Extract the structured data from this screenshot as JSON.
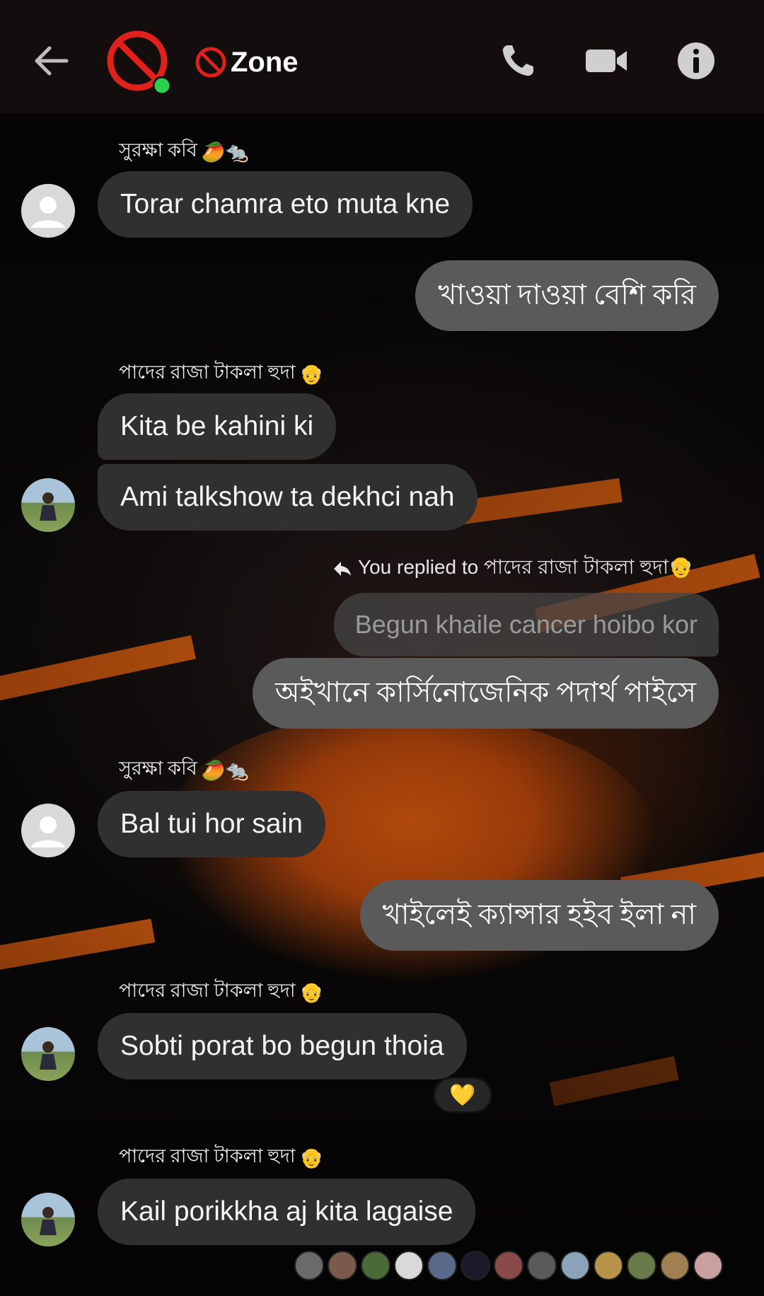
{
  "header": {
    "group_name": "Zone",
    "status": "online"
  },
  "messages": [
    {
      "sender": "সুরক্ষা কবি",
      "sender_emoji": "🥭🐀",
      "text": "Torar chamra eto muta kne"
    },
    {
      "outgoing": "খাওয়া দাওয়া বেশি করি"
    },
    {
      "sender": "পাদের রাজা টাকলা হুদা",
      "sender_emoji": "👴",
      "text1": "Kita be kahini ki",
      "text2": "Ami talkshow ta dekhci nah"
    },
    {
      "reply_note": "You replied to পাদের রাজা টাকলা হুদা👴",
      "quoted": "Begun khaile cancer hoibo kor",
      "outgoing": "অইখানে কার্সিনোজেনিক পদার্থ পাইসে"
    },
    {
      "sender": "সুরক্ষা কবি",
      "sender_emoji": "🥭🐀",
      "text": "Bal tui hor sain"
    },
    {
      "outgoing": "খাইলেই ক্যান্সার হইব ইলা না"
    },
    {
      "sender": "পাদের রাজা টাকলা হুদা",
      "sender_emoji": "👴",
      "text": "Sobti porat bo begun thoia",
      "reaction": "💛"
    },
    {
      "sender": "পাদের রাজা টাকলা হুদা",
      "sender_emoji": "👴",
      "text": "Kail porikkha aj kita lagaise"
    }
  ],
  "colors": {
    "header_bg": "#140d0d",
    "incoming_bubble": "#303030",
    "outgoing_bubble": "#5a5a5a",
    "accent_red": "#e0201b",
    "online_green": "#2bd14e",
    "orange": "#d9590c"
  },
  "icons": {
    "back": "arrow-left-icon",
    "group": "no-entry-icon",
    "call": "phone-icon",
    "video": "video-camera-icon",
    "info": "info-icon",
    "reply": "reply-arrow-icon"
  }
}
